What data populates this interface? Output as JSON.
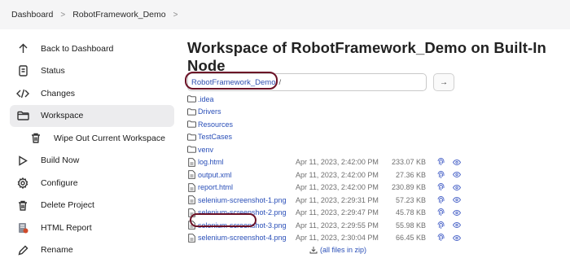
{
  "breadcrumb": {
    "items": [
      "Dashboard",
      "RobotFramework_Demo"
    ],
    "separator": ">"
  },
  "sidebar": {
    "items": [
      {
        "label": "Back to Dashboard",
        "icon": "arrow-up-icon"
      },
      {
        "label": "Status",
        "icon": "document-icon"
      },
      {
        "label": "Changes",
        "icon": "code-icon"
      },
      {
        "label": "Workspace",
        "icon": "folder-icon",
        "active": true
      },
      {
        "label": "Wipe Out Current Workspace",
        "icon": "trash-icon",
        "sub": true
      },
      {
        "label": "Build Now",
        "icon": "play-icon"
      },
      {
        "label": "Configure",
        "icon": "gear-icon"
      },
      {
        "label": "Delete Project",
        "icon": "trash-icon"
      },
      {
        "label": "HTML Report",
        "icon": "report-icon"
      },
      {
        "label": "Rename",
        "icon": "pencil-icon"
      }
    ]
  },
  "main": {
    "title": "Workspace of RobotFramework_Demo on Built-In Node",
    "path": {
      "label": "RobotFramework_Demo",
      "slash": "/"
    },
    "go_label": "→",
    "folders": [
      ".idea",
      "Drivers",
      "Resources",
      "TestCases",
      "venv"
    ],
    "files": [
      {
        "name": "log.html",
        "date": "Apr 11, 2023, 2:42:00 PM",
        "size": "233.07 KB"
      },
      {
        "name": "output.xml",
        "date": "Apr 11, 2023, 2:42:00 PM",
        "size": "27.36 KB"
      },
      {
        "name": "report.html",
        "date": "Apr 11, 2023, 2:42:00 PM",
        "size": "230.89 KB"
      },
      {
        "name": "selenium-screenshot-1.png",
        "date": "Apr 11, 2023, 2:29:31 PM",
        "size": "57.23 KB"
      },
      {
        "name": "selenium-screenshot-2.png",
        "date": "Apr 11, 2023, 2:29:47 PM",
        "size": "45.78 KB"
      },
      {
        "name": "selenium-screenshot-3.png",
        "date": "Apr 11, 2023, 2:29:55 PM",
        "size": "55.98 KB"
      },
      {
        "name": "selenium-screenshot-4.png",
        "date": "Apr 11, 2023, 2:30:04 PM",
        "size": "66.45 KB"
      }
    ],
    "zip_label": "(all files in zip)"
  },
  "colors": {
    "link": "#2a4fb8",
    "highlight": "#6b1126",
    "active_bg": "#ececee"
  }
}
